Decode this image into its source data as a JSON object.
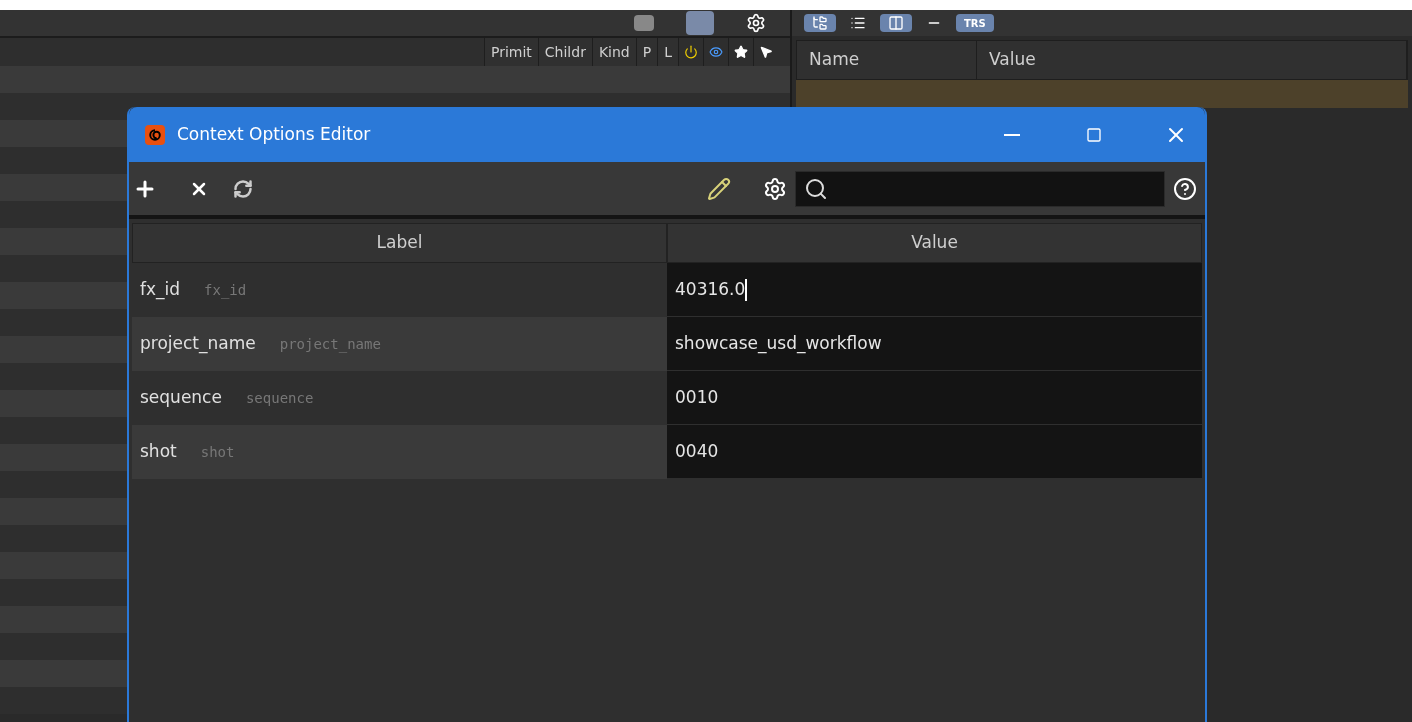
{
  "scene_graph": {
    "columns": [
      {
        "label": "Primit"
      },
      {
        "label": "Childr"
      },
      {
        "label": "Kind"
      },
      {
        "label": "P"
      },
      {
        "label": "L"
      }
    ],
    "icon_columns": [
      {
        "kind": "power"
      },
      {
        "kind": "eye"
      },
      {
        "kind": "star"
      },
      {
        "kind": "pointer"
      }
    ]
  },
  "properties": {
    "toolbar": [
      {
        "kind": "tree",
        "selected": true
      },
      {
        "kind": "list",
        "selected": false
      },
      {
        "kind": "columns",
        "selected": true
      },
      {
        "kind": "line",
        "selected": false
      },
      {
        "kind": "text",
        "label": "TRS",
        "selected": true
      }
    ],
    "columns": [
      "Name",
      "Value"
    ]
  },
  "dialog": {
    "title": "Context Options Editor",
    "columns": [
      "Label",
      "Value"
    ],
    "rows": [
      {
        "label": "fx_id",
        "name": "fx_id",
        "value": "40316.0",
        "editing": true
      },
      {
        "label": "project_name",
        "name": "project_name",
        "value": "showcase_usd_workflow",
        "editing": false
      },
      {
        "label": "sequence",
        "name": "sequence",
        "value": "0010",
        "editing": false
      },
      {
        "label": "shot",
        "name": "shot",
        "value": "0040",
        "editing": false
      }
    ]
  }
}
